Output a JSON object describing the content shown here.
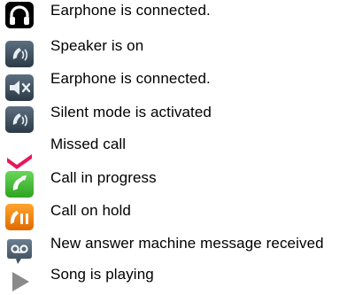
{
  "legend": {
    "items": [
      {
        "icon": "headphones-icon",
        "label": "Earphone is connected."
      },
      {
        "icon": "speaker-phone-icon",
        "label": "Speaker is on"
      },
      {
        "icon": "speaker-muted-icon",
        "label": "Earphone is connected."
      },
      {
        "icon": "silent-mode-icon",
        "label": "Silent mode is activated"
      },
      {
        "icon": "missed-call-icon",
        "label": "Missed call"
      },
      {
        "icon": "call-in-progress-icon",
        "label": "Call in progress"
      },
      {
        "icon": "call-on-hold-icon",
        "label": "Call on hold"
      },
      {
        "icon": "voicemail-icon",
        "label": "New answer machine message received"
      },
      {
        "icon": "play-icon",
        "label": "Song is playing"
      }
    ]
  },
  "colors": {
    "headphones_bg": "#000000",
    "tile_dark": "#3a4a58",
    "missed_call": "#e8175d",
    "call_in_progress": "#3dbb2e",
    "call_on_hold": "#f07d00",
    "voicemail": "#4a5d6e",
    "play": "#8a8a8a"
  }
}
